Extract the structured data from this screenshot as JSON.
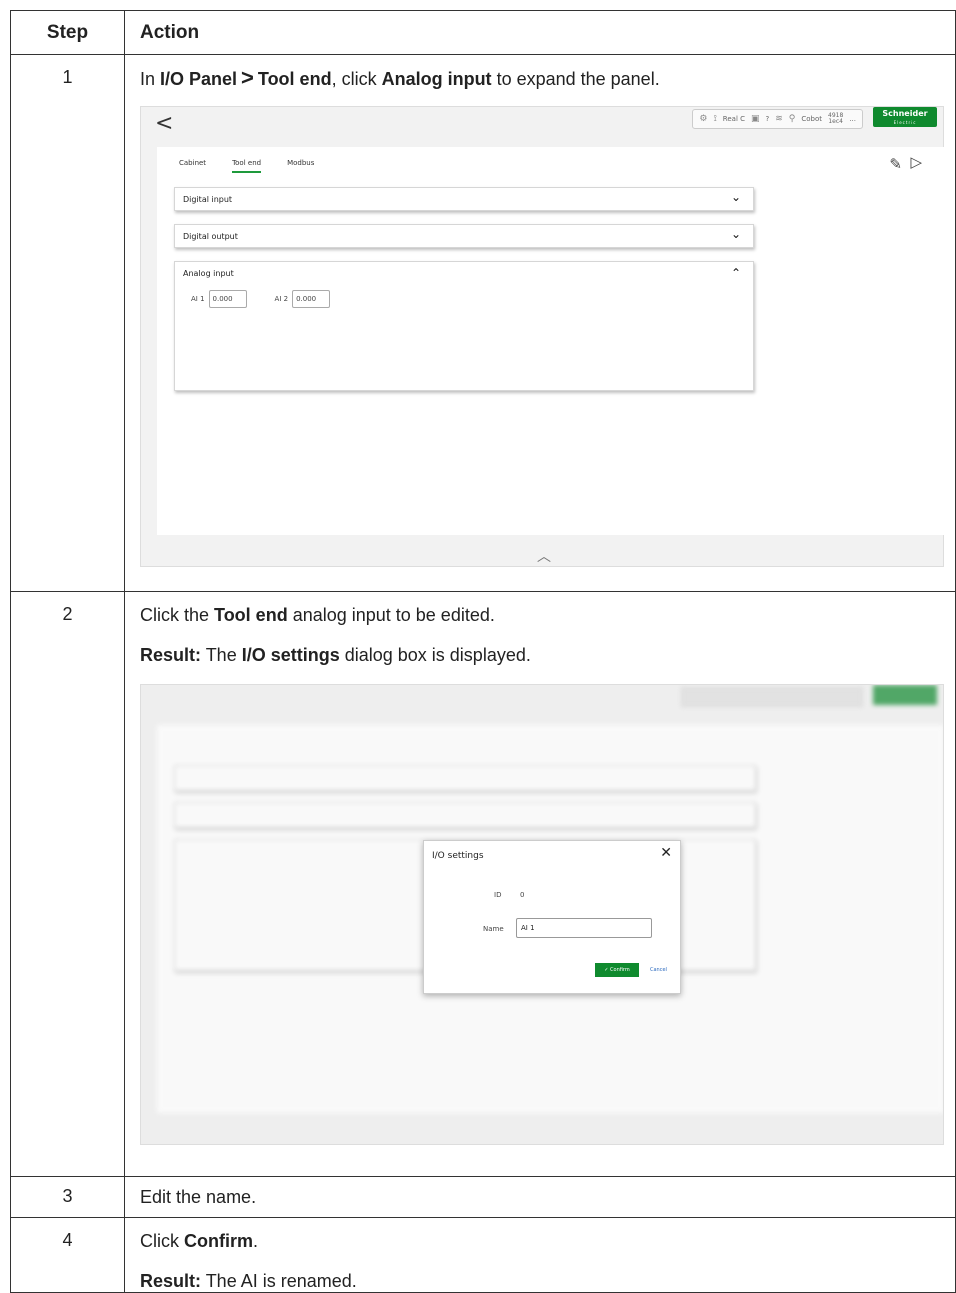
{
  "table": {
    "headers": {
      "step": "Step",
      "action": "Action"
    }
  },
  "steps": [
    {
      "num": "1",
      "text": {
        "pre": "In ",
        "b1": "I/O Panel",
        "gt": ">",
        "b2": "Tool end",
        "mid": ", click ",
        "b3": "Analog input",
        "post": " to expand the panel."
      }
    },
    {
      "num": "2",
      "text": {
        "pre": "Click the ",
        "b1": "Tool end",
        "post": " analog input to be edited."
      },
      "result": {
        "label": "Result:",
        "pre": " The ",
        "b1": "I/O settings",
        "post": " dialog box is displayed."
      }
    },
    {
      "num": "3",
      "text": "Edit the name."
    },
    {
      "num": "4",
      "text": {
        "pre": "Click ",
        "b1": "Confirm",
        "post": "."
      },
      "result": {
        "label": "Result:",
        "post": " The AI is renamed."
      }
    }
  ],
  "screen1": {
    "back": "<",
    "status": {
      "real": "Real C",
      "help": "?",
      "cobot": "Cobot",
      "count_top": "4918",
      "count_bottom": "1ec4",
      "more": "..."
    },
    "brand": {
      "name": "Schneider",
      "sub": "Electric"
    },
    "tabs": [
      "Cabinet",
      "Tool end",
      "Modbus"
    ],
    "sections": [
      {
        "title": "Digital input",
        "chevron": "⌄"
      },
      {
        "title": "Digital output",
        "chevron": "⌄"
      },
      {
        "title": "Analog input",
        "chevron": "⌃"
      }
    ],
    "analog": [
      {
        "label": "AI 1",
        "value": "0.000"
      },
      {
        "label": "AI 2",
        "value": "0.000"
      }
    ]
  },
  "dialog": {
    "title": "I/O settings",
    "id_label": "ID",
    "id_value": "0",
    "name_label": "Name",
    "name_value": "AI 1",
    "confirm": "✓ Confirm",
    "cancel": "Cancel"
  }
}
